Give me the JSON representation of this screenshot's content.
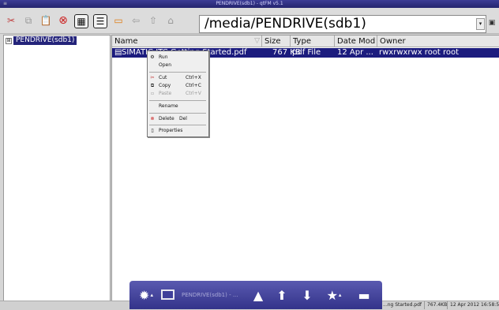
{
  "window": {
    "title": "PENDRIVE(sdb1) - qtFM v5.1"
  },
  "toolbar": {
    "buttons": [
      {
        "name": "cut-icon",
        "glyph": "✂"
      },
      {
        "name": "copy-icon",
        "glyph": "⧉"
      },
      {
        "name": "paste-icon",
        "glyph": "📋"
      },
      {
        "name": "delete-icon",
        "glyph": "⊗"
      },
      {
        "name": "icon-view-icon",
        "glyph": "▦"
      },
      {
        "name": "detail-view-icon",
        "glyph": "☰"
      },
      {
        "name": "folder-icon",
        "glyph": "▭"
      },
      {
        "name": "back-icon",
        "glyph": "⇦"
      },
      {
        "name": "up-icon",
        "glyph": "⇧"
      },
      {
        "name": "home-icon",
        "glyph": "⌂"
      }
    ],
    "path": "/media/PENDRIVE(sdb1)"
  },
  "tree": {
    "expander": "⊞",
    "label": "PENDRIVE(sdb1)"
  },
  "files": {
    "columns": [
      "Name",
      "Size",
      "Type",
      "Date Mod",
      "Owner"
    ],
    "rows": [
      {
        "name": "SIMATIC ITC Getting Started.pdf",
        "size": "767 KB",
        "type": "pdf File",
        "date": "12 Apr ...",
        "owner": "rwxrwxrwx root root"
      }
    ]
  },
  "context_menu": {
    "items": [
      {
        "icon": "run-icon",
        "glyph": "⚙",
        "label": "Run",
        "shortcut": "",
        "disabled": false
      },
      {
        "icon": "",
        "glyph": "",
        "label": "Open",
        "shortcut": "",
        "disabled": false
      },
      {
        "icon": "cut-icon",
        "glyph": "✂",
        "label": "Cut",
        "shortcut": "Ctrl+X",
        "disabled": false
      },
      {
        "icon": "copy-icon",
        "glyph": "⧉",
        "label": "Copy",
        "shortcut": "Ctrl+C",
        "disabled": false
      },
      {
        "icon": "paste-icon",
        "glyph": "▫",
        "label": "Paste",
        "shortcut": "Ctrl+V",
        "disabled": true
      },
      {
        "icon": "",
        "glyph": "",
        "label": "Rename",
        "shortcut": "",
        "disabled": false
      },
      {
        "icon": "delete-icon",
        "glyph": "⊗",
        "label": "Delete",
        "shortcut": "Del",
        "disabled": false
      },
      {
        "icon": "properties-icon",
        "glyph": "▯",
        "label": "Properties",
        "shortcut": "",
        "disabled": false
      }
    ]
  },
  "statusbar": {
    "file": "...ng Started.pdf",
    "size": "767.4KB",
    "date": "12 Apr 2012 16:58:5"
  },
  "dock": {
    "task_label": "PENDRIVE(sdb1) - ...",
    "gear_glyph": "✹",
    "caret_glyph": "▴",
    "eject_glyph": "▲",
    "up_glyph": "⬆",
    "down_glyph": "⬇",
    "star_glyph": "★",
    "menu_glyph": "▬"
  }
}
